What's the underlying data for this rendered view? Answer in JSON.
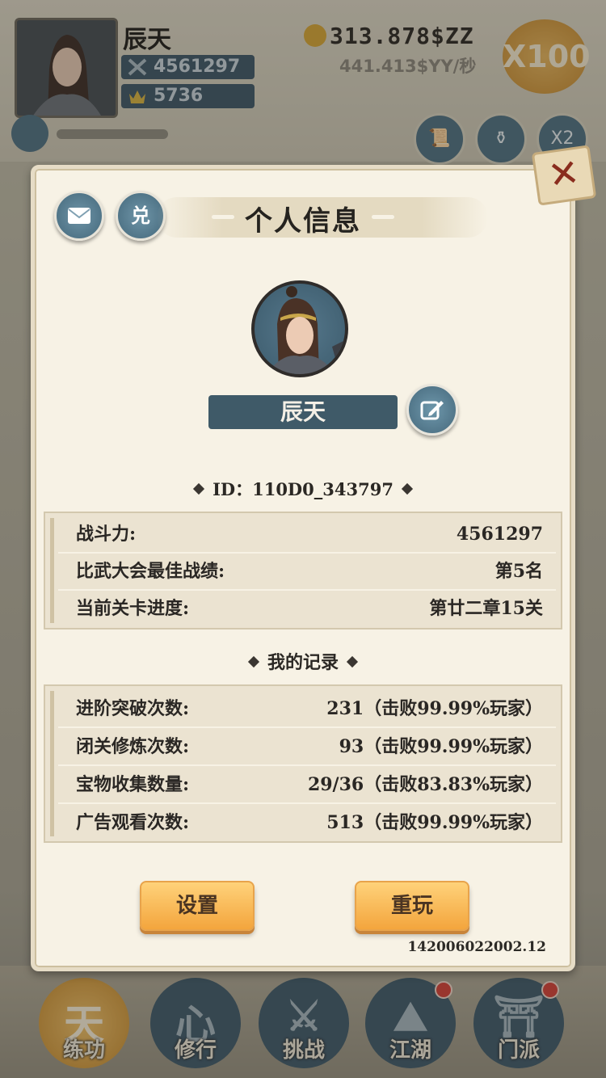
{
  "hud": {
    "player_name": "辰天",
    "power": "4561297",
    "ingots": "5736",
    "gold": "313.878$ZZ",
    "gold_rate": "441.413$YY/秒",
    "speed_multiplier": "X100",
    "buttons": [
      {
        "icon": "scroll-icon",
        "label": "任务"
      },
      {
        "icon": "furnace-icon",
        "label": "丹药"
      },
      {
        "icon": "multiplier-icon",
        "label": "X2"
      }
    ]
  },
  "nav": {
    "items": [
      {
        "label": "练功",
        "glyph": "天",
        "badge": false
      },
      {
        "label": "修行",
        "glyph": "心",
        "badge": false
      },
      {
        "label": "挑战",
        "glyph": "⚔",
        "badge": false
      },
      {
        "label": "江湖",
        "glyph": "⛰",
        "badge": true
      },
      {
        "label": "门派",
        "glyph": "⛩",
        "badge": true
      }
    ]
  },
  "modal": {
    "title": "个人信息",
    "mail_icon": "mail-icon",
    "redeem_label": "兑",
    "name": "辰天",
    "id_text": "ID：110D0_343797",
    "stats": [
      {
        "label": "战斗力:",
        "value": "4561297"
      },
      {
        "label": "比武大会最佳战绩:",
        "value": "第5名"
      },
      {
        "label": "当前关卡进度:",
        "value": "第廿二章15关"
      }
    ],
    "records_title": "我的记录",
    "records": [
      {
        "label": "进阶突破次数:",
        "value": "231（击败99.99%玩家）"
      },
      {
        "label": "闭关修炼次数:",
        "value": "93（击败99.99%玩家）"
      },
      {
        "label": "宝物收集数量:",
        "value": "29/36（击败83.83%玩家）"
      },
      {
        "label": "广告观看次数:",
        "value": "513（击败99.99%玩家）"
      }
    ],
    "settings_label": "设置",
    "replay_label": "重玩",
    "version": "142006022002.12"
  },
  "colors": {
    "accent_orange": "#f3a53d",
    "slate_blue": "#3f5a68",
    "panel_bg": "#ebe3d1",
    "modal_bg": "#f7f2e5"
  }
}
